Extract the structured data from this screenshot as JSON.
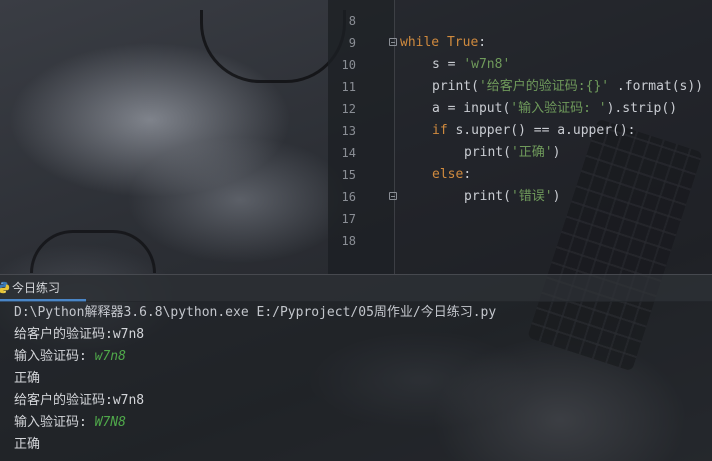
{
  "editor": {
    "lines": [
      {
        "num": "8",
        "tokens": []
      },
      {
        "num": "9",
        "fold": true,
        "tokens": [
          {
            "t": "kw",
            "v": "while "
          },
          {
            "t": "kw",
            "v": "True"
          },
          {
            "t": "fn",
            "v": ":"
          }
        ]
      },
      {
        "num": "10",
        "indent": 1,
        "tokens": [
          {
            "t": "fn",
            "v": "s = "
          },
          {
            "t": "str",
            "v": "'w7n8'"
          }
        ]
      },
      {
        "num": "11",
        "indent": 1,
        "tokens": [
          {
            "t": "fn",
            "v": "print("
          },
          {
            "t": "str",
            "v": "'给客户的验证码:{}'"
          },
          {
            "t": "fn",
            "v": " .format(s))"
          }
        ]
      },
      {
        "num": "12",
        "indent": 1,
        "tokens": [
          {
            "t": "fn",
            "v": "a = input("
          },
          {
            "t": "str",
            "v": "'输入验证码: '"
          },
          {
            "t": "fn",
            "v": ").strip()"
          }
        ]
      },
      {
        "num": "13",
        "indent": 1,
        "tokens": [
          {
            "t": "kw",
            "v": "if "
          },
          {
            "t": "fn",
            "v": "s.upper() == a.upper():"
          }
        ]
      },
      {
        "num": "14",
        "indent": 2,
        "tokens": [
          {
            "t": "fn",
            "v": "print("
          },
          {
            "t": "str",
            "v": "'正确'"
          },
          {
            "t": "fn",
            "v": ")"
          }
        ]
      },
      {
        "num": "15",
        "indent": 1,
        "tokens": [
          {
            "t": "kw",
            "v": "else"
          },
          {
            "t": "fn",
            "v": ":"
          }
        ]
      },
      {
        "num": "16",
        "indent": 2,
        "fold": true,
        "tokens": [
          {
            "t": "fn",
            "v": "print("
          },
          {
            "t": "str",
            "v": "'错误'"
          },
          {
            "t": "fn",
            "v": ")"
          }
        ]
      },
      {
        "num": "17",
        "tokens": []
      },
      {
        "num": "18",
        "tokens": []
      }
    ]
  },
  "run_panel": {
    "tab_label": "今日练习",
    "tab_icon": "python-icon"
  },
  "console": {
    "command": "D:\\Python解释器3.6.8\\python.exe E:/Pyproject/05周作业/今日练习.py",
    "lines": [
      {
        "prompt": "给客户的验证码:w7n8",
        "input": ""
      },
      {
        "prompt": "输入验证码: ",
        "input": "w7n8"
      },
      {
        "prompt": "正确",
        "input": ""
      },
      {
        "prompt": "给客户的验证码:w7n8",
        "input": ""
      },
      {
        "prompt": "输入验证码: ",
        "input": "W7N8"
      },
      {
        "prompt": "正确",
        "input": ""
      }
    ]
  },
  "colors": {
    "keyword": "#d08a3e",
    "string": "#6f9a5b",
    "user_input": "#4fa84a",
    "tab_underline": "#4a86c7"
  }
}
